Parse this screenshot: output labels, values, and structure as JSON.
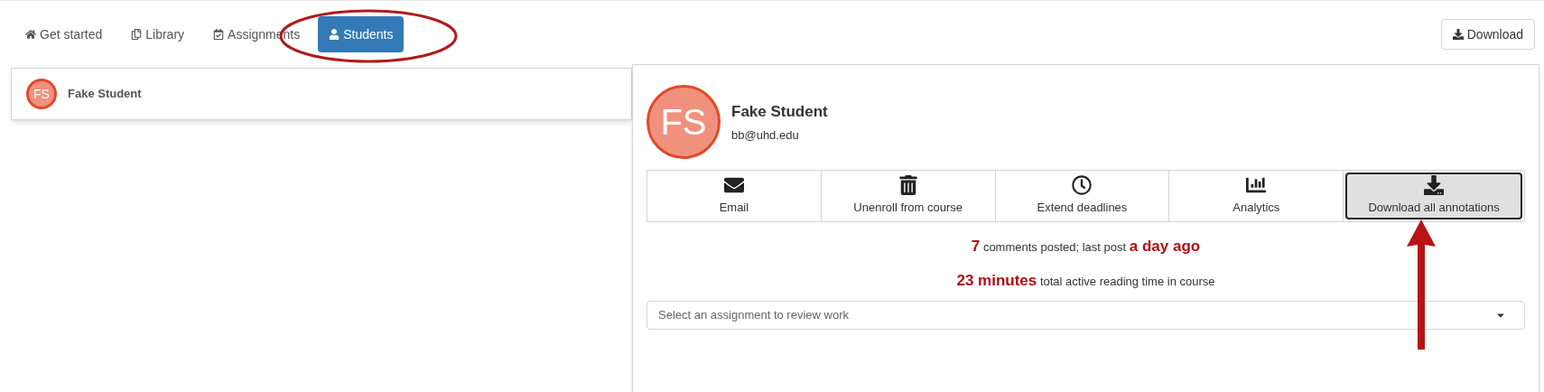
{
  "tabs": [
    {
      "label": "Get started",
      "selected": false
    },
    {
      "label": "Library",
      "selected": false
    },
    {
      "label": "Assignments",
      "selected": false
    },
    {
      "label": "Students",
      "selected": true
    }
  ],
  "download_button": "Download",
  "student_list": [
    {
      "initials": "FS",
      "name": "Fake Student"
    }
  ],
  "profile": {
    "initials": "FS",
    "name": "Fake Student",
    "email": "bb@uhd.edu"
  },
  "actions": [
    {
      "label": "Email",
      "selected": false
    },
    {
      "label": "Unenroll from course",
      "selected": false
    },
    {
      "label": "Extend deadlines",
      "selected": false
    },
    {
      "label": "Analytics",
      "selected": false
    },
    {
      "label": "Download all annotations",
      "selected": true
    }
  ],
  "stats": [
    "**7** comments posted; last post **a day ago**",
    "**23 minutes** total active reading time in course"
  ],
  "assignment_select": {
    "placeholder": "Select an assignment to review work"
  }
}
